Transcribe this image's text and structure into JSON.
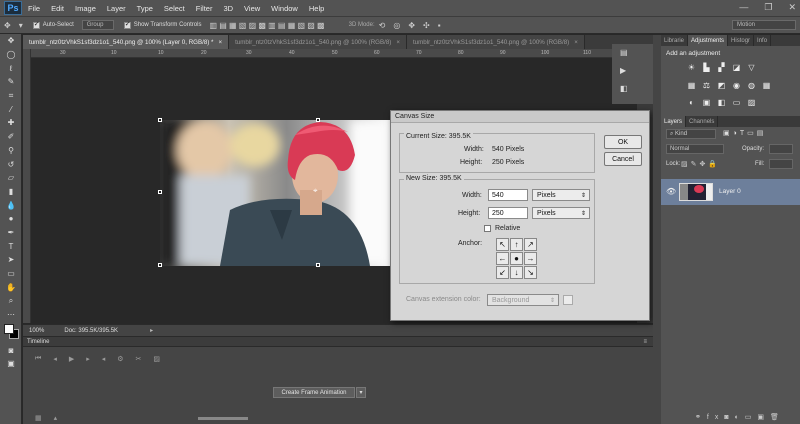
{
  "app": {
    "logo": "Ps"
  },
  "menu": [
    "File",
    "Edit",
    "Image",
    "Layer",
    "Type",
    "Select",
    "Filter",
    "3D",
    "View",
    "Window",
    "Help"
  ],
  "window_controls": {
    "minimize": "—",
    "maximize": "❐",
    "close": "✕"
  },
  "options_bar": {
    "auto_select_label": "Auto-Select",
    "group_value": "Group",
    "show_transform_label": "Show Transform Controls",
    "mode_3d_label": "3D Mode:",
    "workspace_value": "Motion"
  },
  "tabs": [
    {
      "label": "tumblr_ntz0tzVhkS1sf3dz1o1_540.png @ 100% (Layer 0, RGB/8) *",
      "close": "×"
    },
    {
      "label": "tumblr_ntz0tzVhkS1sf3dz1o1_540.png @ 100% (RGB/8)",
      "close": "×"
    },
    {
      "label": "tumblr_ntz0tzVhkS1sf3dz1o1_540.png @ 100% (RGB/8)",
      "close": "×"
    }
  ],
  "ruler_ticks": [
    "30",
    "10",
    "10",
    "20",
    "30",
    "40",
    "50",
    "60",
    "70",
    "80",
    "90",
    "100",
    "110",
    "120"
  ],
  "status": {
    "zoom": "100%",
    "doc": "Doc: 395.5K/395.5K"
  },
  "timeline": {
    "title": "Timeline",
    "create_button": "Create Frame Animation"
  },
  "dialog": {
    "title": "Canvas Size",
    "current_size_label": "Current Size: 395.5K",
    "width_label": "Width:",
    "width_value": "540 Pixels",
    "height_label": "Height:",
    "height_value": "250 Pixels",
    "new_size_label": "New Size: 395.5K",
    "new_width": "540",
    "new_height": "250",
    "unit_width": "Pixels",
    "unit_height": "Pixels",
    "relative_label": "Relative",
    "anchor_label": "Anchor:",
    "anchor_cells": [
      "↖",
      "↑",
      "↗",
      "←",
      "●",
      "→",
      "↙",
      "↓",
      "↘"
    ],
    "extension_label": "Canvas extension color:",
    "extension_value": "Background",
    "ok": "OK",
    "cancel": "Cancel"
  },
  "panels": {
    "tabs_top": [
      "Librarie",
      "Adjustments",
      "Histogr",
      "Info"
    ],
    "add_adjustment": "Add an adjustment",
    "tabs_layers": [
      "Layers",
      "Channels"
    ],
    "kind_label": "Kind",
    "blend_mode": "Normal",
    "opacity_label": "Opacity:",
    "lock_label": "Lock:",
    "fill_label": "Fill:",
    "layer_name": "Layer 0"
  },
  "colors": {
    "accent_layer": "#6d7f9b",
    "hair": "#d93a55",
    "app_bg": "#282828"
  }
}
